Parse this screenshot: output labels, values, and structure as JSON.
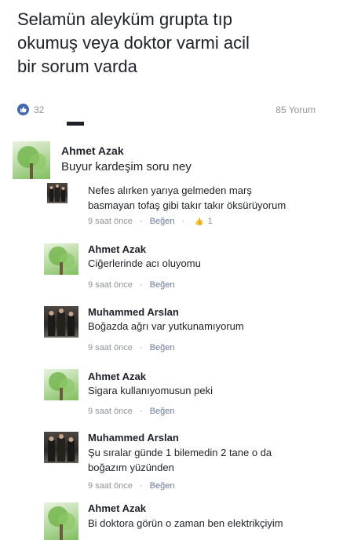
{
  "post": {
    "lines": [
      "Selamün aleyküm grupta tıp",
      "okumuş veya doktor varmi acil",
      "bir sorum varda"
    ]
  },
  "reactions": {
    "like_count": "32",
    "comment_count": "85 Yorum",
    "like_icon_color": "#4267b2"
  },
  "main_comment": {
    "author": "Ahmet Azak",
    "text": "Buyur kardeşim soru ney",
    "avatar_icon": "tree-avatar"
  },
  "replies": [
    {
      "author": "",
      "lines": [
        "Nefes alırken yarıya gelmeden marş",
        "basmayan tofaş gibi takır takır öksürüyorum"
      ],
      "time": "9 saat önce",
      "like_label": "Beğen",
      "like_count": "1",
      "avatar_icon": "photo-avatar"
    },
    {
      "author": "Ahmet Azak",
      "lines": [
        "Ciğerlerinde acı oluyomu"
      ],
      "time": "9 saat önce",
      "like_label": "Beğen",
      "avatar_icon": "tree-avatar"
    },
    {
      "author": "Muhammed Arslan",
      "lines": [
        "Boğazda ağrı var yutkunamıyorum"
      ],
      "time": "9 saat önce",
      "like_label": "Beğen",
      "avatar_icon": "photo-avatar"
    },
    {
      "author": "Ahmet Azak",
      "lines": [
        "Sigara kullanıyomusun peki"
      ],
      "time": "9 saat önce",
      "like_label": "Beğen",
      "avatar_icon": "tree-avatar"
    },
    {
      "author": "Muhammed Arslan",
      "lines": [
        "Şu sıralar günde 1 bilemedin 2 tane o da",
        "boğazım yüzünden"
      ],
      "time": "9 saat önce",
      "like_label": "Beğen",
      "avatar_icon": "photo-avatar"
    },
    {
      "author": "Ahmet Azak",
      "lines": [
        "Bi doktora görün o zaman ben elektrikçiyim"
      ],
      "avatar_icon": "tree-avatar"
    }
  ],
  "meta_separator": "·",
  "mini_like_glyph": "👍"
}
